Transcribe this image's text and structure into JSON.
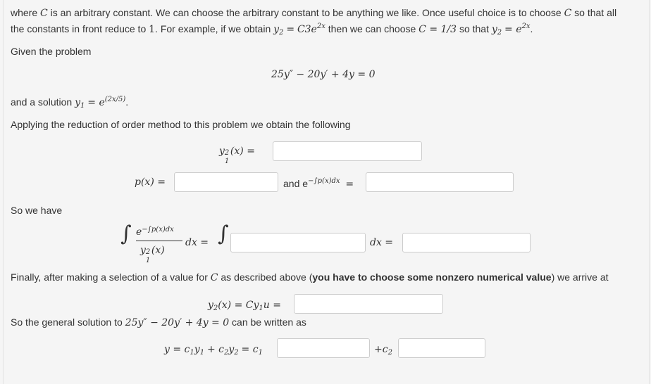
{
  "intro": {
    "line1_a": "where",
    "line1_C": "C",
    "line1_b": "is an arbitrary constant. We can choose the arbitrary constant to be anything we like. Once useful choice is to choose",
    "line1_C2": "C",
    "line1_c": "so that all",
    "line2_a": "the constants in front reduce to",
    "line2_one": "1",
    "line2_b": ". For example, if we obtain",
    "line2_y2": "y",
    "line2_sub2": "2",
    "line2_eq": "=",
    "line2_expr": "C3e",
    "line2_exp": "2x",
    "line2_c": "then we can choose",
    "line2_Ceq": "C = 1/3",
    "line2_d": "so that",
    "line2_y2b": "y",
    "line2_sub2b": "2",
    "line2_eq2": "= e",
    "line2_exp2": "2x",
    "line2_dot": "."
  },
  "given": "Given the problem",
  "equation": "25y″ − 20y′ + 4y = 0",
  "solution": {
    "a": "and a solution",
    "y1": "y",
    "sub1": "1",
    "eq": "= e",
    "exp": "(2x/5)",
    "dot": "."
  },
  "applying": "Applying the reduction of order method to this problem we obtain the following",
  "y1sq": {
    "lhs": "y",
    "sup": "2",
    "sub": "1",
    "arg": "(x) ="
  },
  "px": {
    "lhs": "p(x) ="
  },
  "and_e": {
    "a": "and e",
    "exp": "−∫p(x)dx",
    "eq": "="
  },
  "so_we_have": "So we have",
  "integral": {
    "num_e": "e",
    "num_exp": "−∫p(x)dx",
    "den": "y",
    "den_sup": "2",
    "den_sub": "1",
    "den_arg": "(x)",
    "dx": "dx =",
    "dx2": "dx ="
  },
  "finally": {
    "a": "Finally, after making a selection of a value for",
    "C": "C",
    "b": "as described above (",
    "bold": "you have to choose some nonzero numerical value",
    "c": ") we arrive at"
  },
  "y2line": {
    "lhs": "y",
    "sub": "2",
    "rest": "(x) = Cy",
    "sub1": "1",
    "u": "u ="
  },
  "general": {
    "a": "So the general solution to",
    "eq": "25y″ − 20y′ + 4y = 0",
    "b": "can be written as"
  },
  "final_eq": {
    "text": "y = c",
    "s1": "1",
    "y1": "y",
    "s1b": "1",
    "plus": "+ c",
    "s2": "2",
    "y2": "y",
    "s2b": "2",
    "eqc": "= c",
    "s3": "1",
    "plus_c2": "+c",
    "s4": "2"
  },
  "inputs": {
    "y1sq": "",
    "px": "",
    "exp_int": "",
    "integrand": "",
    "integral_result": "",
    "u": "",
    "c1": "",
    "c2": ""
  }
}
